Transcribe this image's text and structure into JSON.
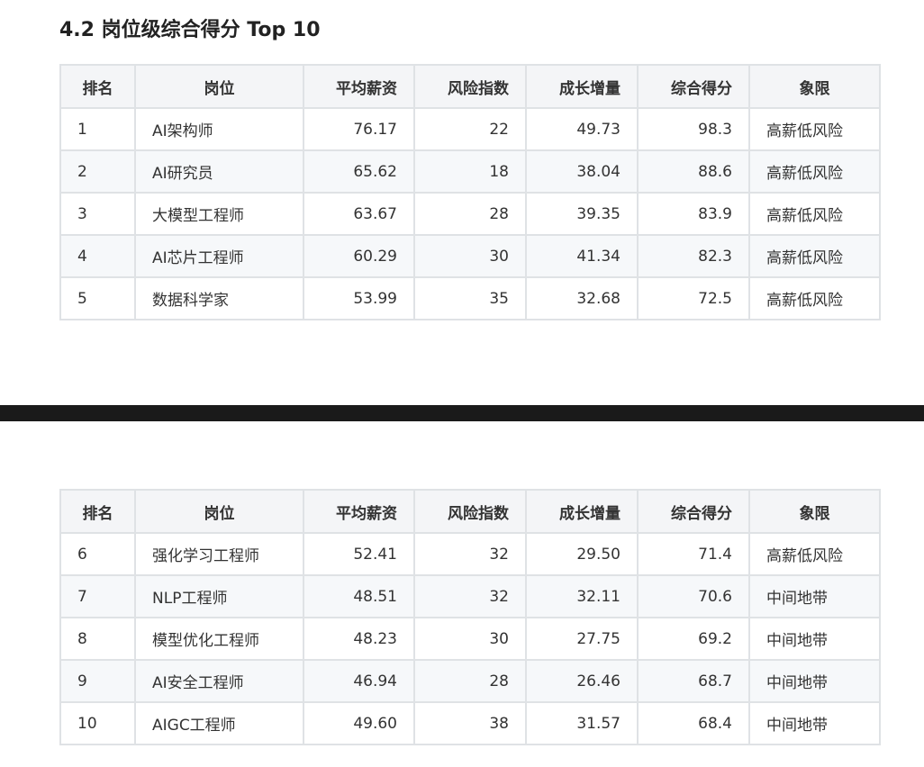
{
  "section": {
    "title": "4.2 岗位级综合得分 Top 10"
  },
  "table": {
    "headers": [
      "排名",
      "岗位",
      "平均薪资",
      "风险指数",
      "成长增量",
      "综合得分",
      "象限"
    ],
    "page1_rows": [
      [
        "1",
        "AI架构师",
        "76.17",
        "22",
        "49.73",
        "98.3",
        "高薪低风险"
      ],
      [
        "2",
        "AI研究员",
        "65.62",
        "18",
        "38.04",
        "88.6",
        "高薪低风险"
      ],
      [
        "3",
        "大模型工程师",
        "63.67",
        "28",
        "39.35",
        "83.9",
        "高薪低风险"
      ],
      [
        "4",
        "AI芯片工程师",
        "60.29",
        "30",
        "41.34",
        "82.3",
        "高薪低风险"
      ],
      [
        "5",
        "数据科学家",
        "53.99",
        "35",
        "32.68",
        "72.5",
        "高薪低风险"
      ]
    ],
    "page2_rows": [
      [
        "6",
        "强化学习工程师",
        "52.41",
        "32",
        "29.50",
        "71.4",
        "高薪低风险"
      ],
      [
        "7",
        "NLP工程师",
        "48.51",
        "32",
        "32.11",
        "70.6",
        "中间地带"
      ],
      [
        "8",
        "模型优化工程师",
        "48.23",
        "30",
        "27.75",
        "69.2",
        "中间地带"
      ],
      [
        "9",
        "AI安全工程师",
        "46.94",
        "28",
        "26.46",
        "68.7",
        "中间地带"
      ],
      [
        "10",
        "AIGC工程师",
        "49.60",
        "38",
        "31.57",
        "68.4",
        "中间地带"
      ]
    ]
  },
  "colors": {
    "header_bg": "#f4f5f7",
    "alt_row_bg": "#f6f8fa",
    "border": "#dfe2e5",
    "page_divider": "#1a1a1a"
  }
}
